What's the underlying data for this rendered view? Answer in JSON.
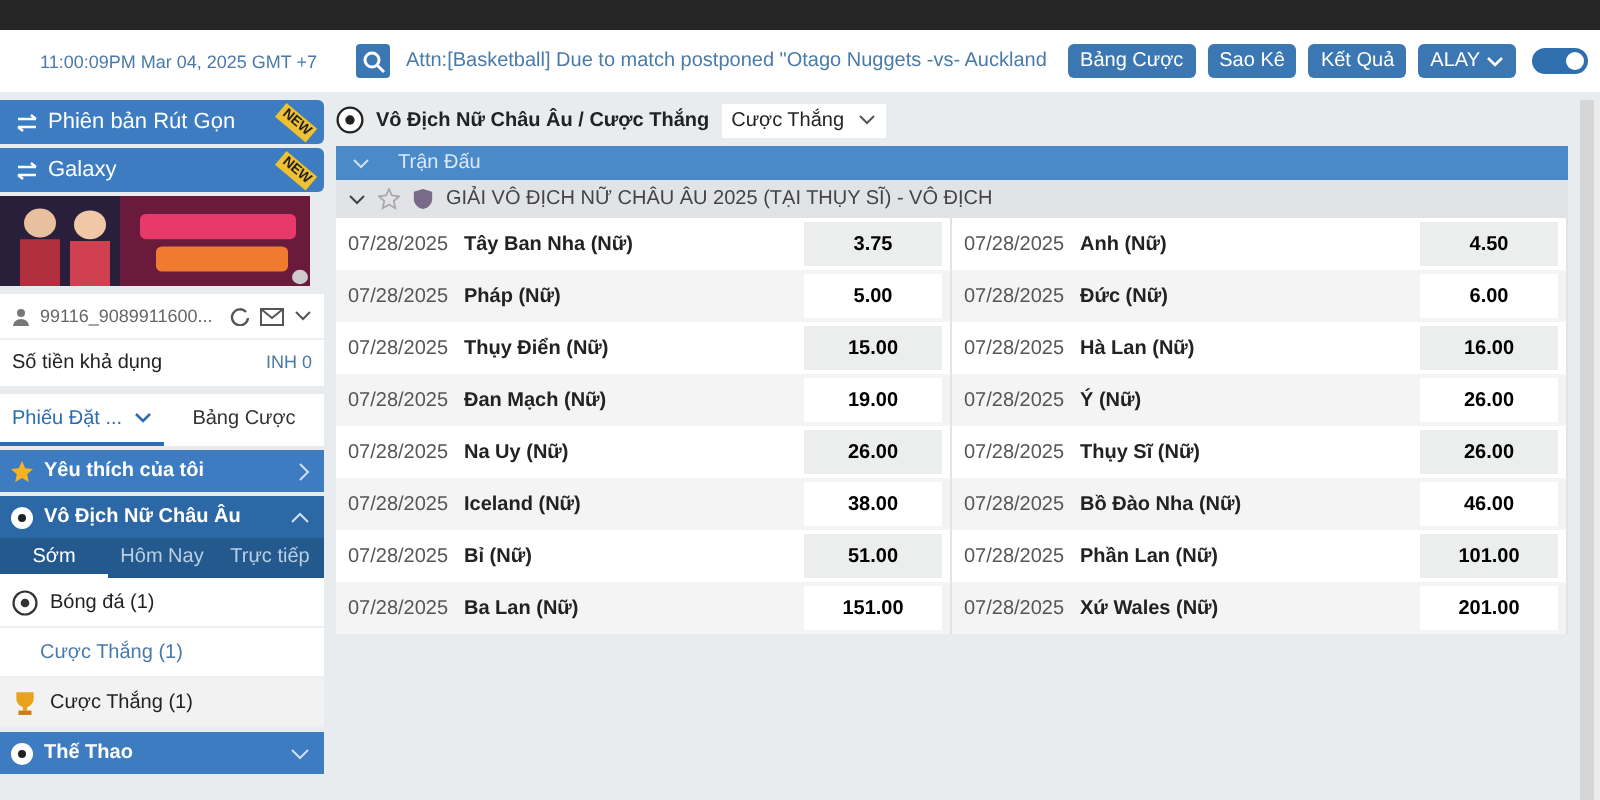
{
  "top_bar": {
    "time": "11:00:09PM Mar 04, 2025 GMT +7",
    "ticker": "Attn:[Basketball] Due to match postponed \"Otago Nuggets -vs- Auckland",
    "buttons": [
      "Bảng Cược",
      "Sao Kê",
      "Kết Quả",
      "ALAY"
    ],
    "toggle_on": true
  },
  "sidebar": {
    "versions": [
      {
        "label": "Phiên bản Rút Gọn",
        "badge": "NEW"
      },
      {
        "label": "Galaxy",
        "badge": "NEW"
      }
    ],
    "account": {
      "user": "99116_9089911600...",
      "balance_label": "Số tiền khả dụng",
      "balance": "INH 0"
    },
    "bet_tabs": [
      {
        "label": "Phiếu Đặt ...",
        "selected": true
      },
      {
        "label": "Bảng Cược",
        "selected": false
      }
    ],
    "favorites": "Yêu thích của tôi",
    "league": {
      "title": "Vô Địch Nữ Châu Âu",
      "expanded": true,
      "tabs": [
        {
          "label": "Sớm",
          "selected": true
        },
        {
          "label": "Hôm Nay",
          "selected": false
        },
        {
          "label": "Trực tiếp",
          "selected": false
        }
      ],
      "items": [
        {
          "kind": "sport",
          "label": "Bóng đá",
          "count": "(1)"
        },
        {
          "kind": "sub",
          "label": "Cược Thắng",
          "count": "(1)"
        },
        {
          "kind": "trophy",
          "label": "Cược Thắng",
          "count": "(1)"
        }
      ]
    },
    "sports": "Thế Thao"
  },
  "main": {
    "title": "Vô Địch Nữ Châu Âu / Cược Thắng",
    "market": "Cược Thắng",
    "section": "Trận Đấu",
    "competition": "GIẢI VÔ ĐỊCH NỮ CHÂU ÂU 2025 (TẠI THỤY SĨ) - VÔ ĐỊCH",
    "rows": [
      [
        {
          "date": "07/28/2025",
          "team": "Tây Ban Nha (Nữ)",
          "odds": "3.75"
        },
        {
          "date": "07/28/2025",
          "team": "Anh (Nữ)",
          "odds": "4.50"
        }
      ],
      [
        {
          "date": "07/28/2025",
          "team": "Pháp (Nữ)",
          "odds": "5.00"
        },
        {
          "date": "07/28/2025",
          "team": "Đức (Nữ)",
          "odds": "6.00"
        }
      ],
      [
        {
          "date": "07/28/2025",
          "team": "Thụy Điển (Nữ)",
          "odds": "15.00"
        },
        {
          "date": "07/28/2025",
          "team": "Hà Lan (Nữ)",
          "odds": "16.00"
        }
      ],
      [
        {
          "date": "07/28/2025",
          "team": "Đan Mạch (Nữ)",
          "odds": "19.00"
        },
        {
          "date": "07/28/2025",
          "team": "Ý (Nữ)",
          "odds": "26.00"
        }
      ],
      [
        {
          "date": "07/28/2025",
          "team": "Na Uy (Nữ)",
          "odds": "26.00"
        },
        {
          "date": "07/28/2025",
          "team": "Thụy Sĩ (Nữ)",
          "odds": "26.00"
        }
      ],
      [
        {
          "date": "07/28/2025",
          "team": "Iceland (Nữ)",
          "odds": "38.00"
        },
        {
          "date": "07/28/2025",
          "team": "Bồ Đào Nha (Nữ)",
          "odds": "46.00"
        }
      ],
      [
        {
          "date": "07/28/2025",
          "team": "Bỉ (Nữ)",
          "odds": "51.00"
        },
        {
          "date": "07/28/2025",
          "team": "Phần Lan (Nữ)",
          "odds": "101.00"
        }
      ],
      [
        {
          "date": "07/28/2025",
          "team": "Ba Lan (Nữ)",
          "odds": "151.00"
        },
        {
          "date": "07/28/2025",
          "team": "Xứ Wales (Nữ)",
          "odds": "201.00"
        }
      ]
    ]
  }
}
